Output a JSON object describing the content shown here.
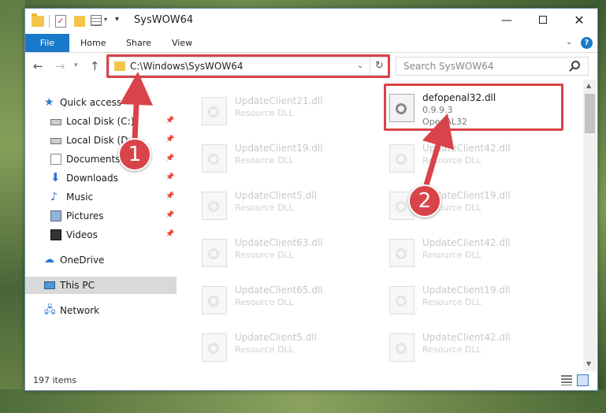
{
  "window": {
    "title": "SysWOW64",
    "controls": {
      "minimize": "—",
      "maximize": "",
      "close": "✕"
    }
  },
  "ribbon": {
    "tabs": [
      "File",
      "Home",
      "Share",
      "View"
    ],
    "help": "?"
  },
  "navigation": {
    "address": "C:\\Windows\\SysWOW64",
    "search_placeholder": "Search SysWOW64"
  },
  "sidebar": {
    "items": [
      {
        "label": "Quick access",
        "icon": "star-icon",
        "pinned": false
      },
      {
        "label": "Local Disk (C:)",
        "icon": "drive-icon",
        "pinned": true
      },
      {
        "label": "Local Disk (D:)",
        "icon": "drive-icon",
        "pinned": true
      },
      {
        "label": "Documents",
        "icon": "documents-icon",
        "pinned": true
      },
      {
        "label": "Downloads",
        "icon": "download-icon",
        "pinned": true
      },
      {
        "label": "Music",
        "icon": "music-icon",
        "pinned": true
      },
      {
        "label": "Pictures",
        "icon": "pictures-icon",
        "pinned": true
      },
      {
        "label": "Videos",
        "icon": "videos-icon",
        "pinned": true
      },
      {
        "label": "OneDrive",
        "icon": "cloud-icon",
        "pinned": false
      },
      {
        "label": "This PC",
        "icon": "pc-icon",
        "pinned": false,
        "selected": true
      },
      {
        "label": "Network",
        "icon": "network-icon",
        "pinned": false
      }
    ]
  },
  "files": {
    "left_column": [
      {
        "name": "UpdateClient21.dll",
        "type": "Resource DLL"
      },
      {
        "name": "UpdateClient19.dll",
        "type": "Resource DLL"
      },
      {
        "name": "UpdateClient5.dll",
        "type": "Resource DLL"
      },
      {
        "name": "UpdateClient63.dll",
        "type": "Resource DLL"
      },
      {
        "name": "UpdateClient65.dll",
        "type": "Resource DLL"
      },
      {
        "name": "UpdateClient5.dll",
        "type": "Resource DLL"
      }
    ],
    "highlighted": {
      "name": "defopenal32.dll",
      "version": "0.9.9.3",
      "type": "OpenAL32"
    },
    "right_column": [
      {
        "name": "UpdateClient42.dll",
        "type": "Resource DLL"
      },
      {
        "name": "UpdateClient19.dll",
        "type": "Resource DLL"
      },
      {
        "name": "UpdateClient42.dll",
        "type": "Resource DLL"
      },
      {
        "name": "UpdateClient19.dll",
        "type": "Resource DLL"
      },
      {
        "name": "UpdateClient42.dll",
        "type": "Resource DLL"
      }
    ]
  },
  "status": {
    "items": "197 items"
  },
  "annotations": {
    "step1": "1",
    "step2": "2"
  },
  "colors": {
    "accent": "#1979ca",
    "highlight": "#d9434a"
  }
}
